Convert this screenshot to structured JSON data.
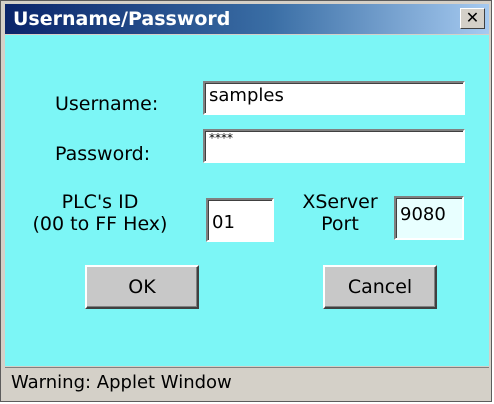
{
  "window": {
    "title": "Username/Password",
    "close_glyph": "✕"
  },
  "form": {
    "username_label": "Username:",
    "username_value": "samples",
    "password_label": "Password:",
    "password_value": "****",
    "plc_id_label_line1": "PLC's ID",
    "plc_id_label_line2": "(00 to FF Hex)",
    "plc_id_value": "01",
    "xserver_label_line1": "XServer",
    "xserver_label_line2": "Port",
    "xserver_port_value": "9080"
  },
  "buttons": {
    "ok_label": "OK",
    "cancel_label": "Cancel"
  },
  "status": {
    "text": "Warning: Applet Window"
  },
  "colors": {
    "titlebar_start": "#0a246a",
    "titlebar_end": "#a6caf0",
    "client_background": "#7cf6f6",
    "window_chrome": "#d4d0c8"
  },
  "icons": {
    "close": "close-icon"
  }
}
